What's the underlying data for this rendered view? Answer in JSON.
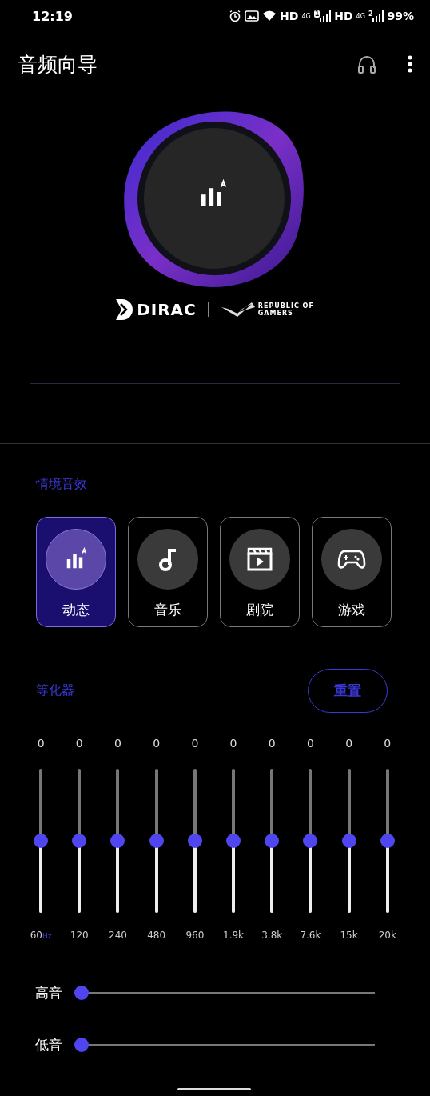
{
  "status_bar": {
    "time": "12:19",
    "network": [
      {
        "hd": "HD",
        "gen": "4G",
        "sim": "1"
      },
      {
        "hd": "HD",
        "gen": "4G",
        "sim": "2"
      }
    ],
    "battery": "99%"
  },
  "app_bar": {
    "title": "音频向导"
  },
  "logos": {
    "dirac": "DIRAC",
    "rog": [
      "REPUBLIC OF",
      "GAMERS"
    ]
  },
  "scenes": {
    "title": "情境音效",
    "items": [
      {
        "label": "动态",
        "kind": "dynamic",
        "selected": true
      },
      {
        "label": "音乐",
        "kind": "music",
        "selected": false
      },
      {
        "label": "剧院",
        "kind": "theater",
        "selected": false
      },
      {
        "label": "游戏",
        "kind": "game",
        "selected": false
      }
    ]
  },
  "equalizer": {
    "title": "等化器",
    "reset": "重置",
    "bands": [
      {
        "value": "0",
        "label": "60",
        "unit": "Hz",
        "level": 0.5
      },
      {
        "value": "0",
        "label": "120",
        "level": 0.5
      },
      {
        "value": "0",
        "label": "240",
        "level": 0.5
      },
      {
        "value": "0",
        "label": "480",
        "level": 0.5
      },
      {
        "value": "0",
        "label": "960",
        "level": 0.5
      },
      {
        "value": "0",
        "label": "1.9k",
        "level": 0.5
      },
      {
        "value": "0",
        "label": "3.8k",
        "level": 0.5
      },
      {
        "value": "0",
        "label": "7.6k",
        "level": 0.5
      },
      {
        "value": "0",
        "label": "15k",
        "level": 0.5
      },
      {
        "value": "0",
        "label": "20k",
        "level": 0.5
      }
    ]
  },
  "tone": [
    {
      "label": "高音",
      "level": 0
    },
    {
      "label": "低音",
      "level": 0
    }
  ]
}
